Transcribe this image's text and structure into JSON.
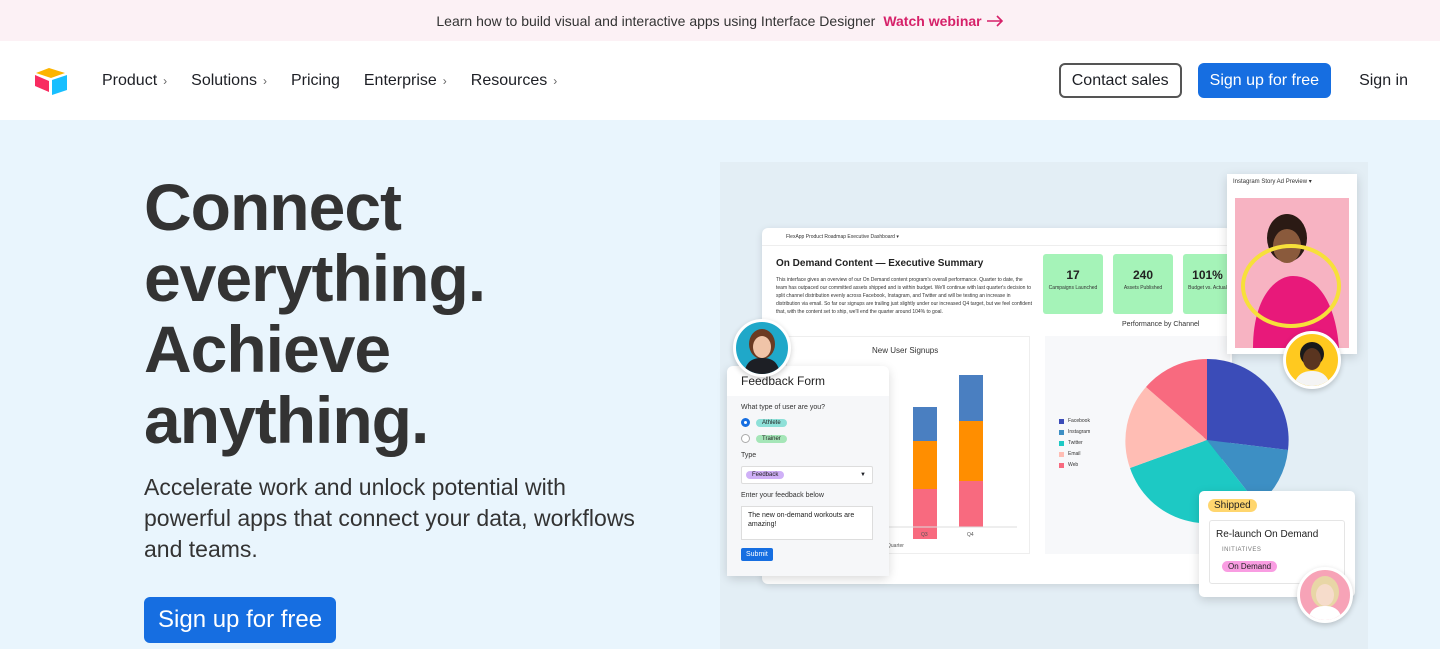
{
  "banner": {
    "text": "Learn how to build visual and interactive apps using Interface Designer",
    "link": "Watch webinar"
  },
  "nav": {
    "items": [
      {
        "label": "Product",
        "has_chevron": true
      },
      {
        "label": "Solutions",
        "has_chevron": true
      },
      {
        "label": "Pricing",
        "has_chevron": false
      },
      {
        "label": "Enterprise",
        "has_chevron": true
      },
      {
        "label": "Resources",
        "has_chevron": true
      }
    ],
    "contact_sales": "Contact sales",
    "signup": "Sign up for free",
    "signin": "Sign in"
  },
  "hero": {
    "headline_lines": [
      "Connect",
      "everything.",
      "Achieve",
      "anything."
    ],
    "subhead": "Accelerate work and unlock potential with powerful apps that connect your data, workflows and teams.",
    "cta": "Sign up for free"
  },
  "dashboard": {
    "topbar": "FlexApp Product Roadmap    Executive Dashboard ▾",
    "title": "On Demand Content — Executive Summary",
    "paragraph": "This interface gives an overview of our On Demand content program's overall performance. Quarter to date, the team has outpaced our committed assets shipped and is within budget. We'll continue with last quarter's decision to split channel distribution evenly across Facebook, Instagram, and Twitter and will be testing an increase in distribution via email. So far our signups are trailing just slightly under our increased Q4 target, but we feel confident that, with the content set to ship, we'll end the quarter around 104% to goal.",
    "kpis": [
      {
        "value": "17",
        "label": "Campaigns Launched"
      },
      {
        "value": "240",
        "label": "Assets Published"
      },
      {
        "value": "101%",
        "label": "Budget vs. Actual"
      }
    ],
    "perf_title": "Performance by Channel",
    "signups_title": "New User Signups",
    "signups_axis_labels": [
      "Quarter",
      "Q3",
      "Q4"
    ],
    "legend": [
      {
        "label": "Facebook",
        "color": "#3b4cb8"
      },
      {
        "label": "Instagram",
        "color": "#3d8fc4"
      },
      {
        "label": "Twitter",
        "color": "#1dc9c4"
      },
      {
        "label": "Email",
        "color": "#ffbdb4"
      },
      {
        "label": "Web",
        "color": "#f86a7f"
      }
    ]
  },
  "feedback_form": {
    "title": "Feedback Form",
    "question": "What type of user are you?",
    "options": [
      {
        "label": "Athlete",
        "color": "#8ee0d8",
        "selected": true
      },
      {
        "label": "Trainer",
        "color": "#a5e6b8",
        "selected": false
      }
    ],
    "type_label": "Type",
    "type_value": "Feedback",
    "type_color": "#cfb0f7",
    "feedback_label": "Enter your feedback below",
    "feedback_text": "The new on-demand workouts are amazing!",
    "submit": "Submit"
  },
  "instagram": {
    "title": "Instagram Story Ad Preview ▾"
  },
  "shipped_card": {
    "badge": "Shipped",
    "name": "Re-launch On Demand",
    "initiatives_label": "INITIATIVES",
    "initiative": "On Demand"
  }
}
